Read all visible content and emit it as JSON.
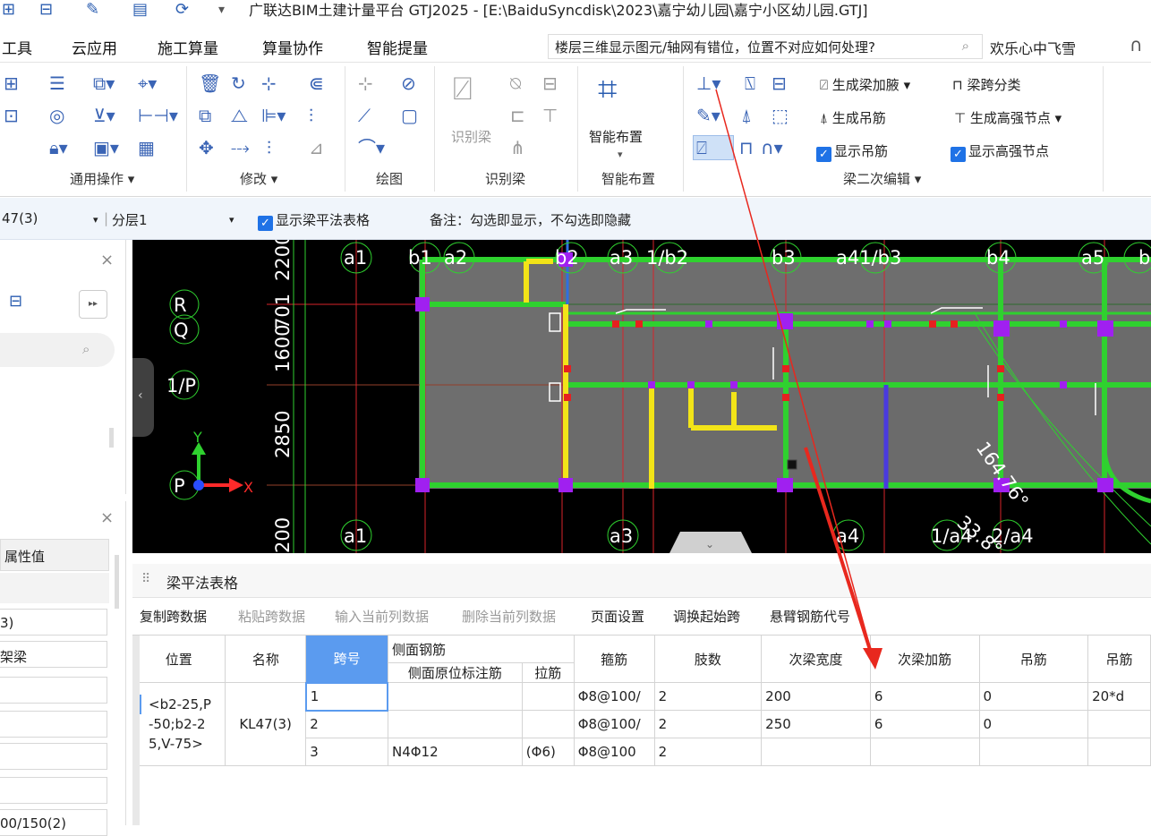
{
  "title_bar": {
    "title": "广联达BIM土建计量平台 GTJ2025 - [E:\\BaiduSyncdisk\\2023\\嘉宁幼儿园\\嘉宁小区幼儿园.GTJ]",
    "quick_icons": [
      "save-icon",
      "grid-icon",
      "pen-icon",
      "table-icon",
      "sync-icon",
      "dropdown-icon"
    ]
  },
  "menu": {
    "items": [
      "工具",
      "云应用",
      "施工算量",
      "算量协作",
      "智能提量"
    ],
    "search_text": "楼层三维显示图元/轴网有错位，位置不对应如何处理?",
    "user": "欢乐心中飞雪"
  },
  "ribbon": {
    "groups": [
      "通用操作",
      "修改",
      "绘图",
      "识别梁",
      "智能布置",
      "梁二次编辑"
    ],
    "identify_beam": "识别梁",
    "smart_layout": "智能布置",
    "beam_edit": {
      "gen_haunch": "生成梁加腋",
      "span_class": "梁跨分类",
      "gen_hanger": "生成吊筋",
      "gen_strong_node": "生成高强节点",
      "show_hanger": "显示吊筋",
      "show_strong_node": "显示高强节点"
    }
  },
  "options_bar": {
    "element": "47(3)",
    "layer": "分层1",
    "show_table": "显示梁平法表格",
    "note": "备注：勾选即显示，不勾选即隐藏"
  },
  "left_panel": {
    "header": "属性值",
    "values": [
      "3)",
      "架梁",
      "",
      "",
      "",
      "",
      "00/150(2)"
    ]
  },
  "canvas": {
    "axes_top": [
      "a1",
      "b1",
      "a2",
      "b2",
      "a3",
      "1/b2",
      "b3",
      "a41/b3",
      "b4",
      "a5",
      "b"
    ],
    "axes_bottom": [
      "a1",
      "a3",
      "a4",
      "1/a4",
      "2/a4"
    ],
    "axes_left": [
      "R",
      "Q",
      "1/P",
      "P"
    ],
    "dims": [
      "2200",
      "701",
      "1600",
      "2850",
      "200"
    ],
    "angles": [
      "164.76°",
      "33.8°"
    ],
    "coord_x": "X",
    "coord_y": "Y"
  },
  "table_panel": {
    "title": "梁平法表格",
    "toolbar": [
      "复制跨数据",
      "粘贴跨数据",
      "输入当前列数据",
      "删除当前列数据",
      "页面设置",
      "调换起始跨",
      "悬臂钢筋代号"
    ],
    "headers": {
      "pos": "位置",
      "name": "名称",
      "span": "跨号",
      "side": "侧面钢筋",
      "side_mark": "侧面原位标注筋",
      "tie": "拉筋",
      "stirrup": "箍筋",
      "legs": "肢数",
      "sec_width": "次梁宽度",
      "sec_add": "次梁加筋",
      "hanger": "吊筋",
      "hanger2": "吊筋"
    },
    "pos_text": [
      "<b2-25,P",
      "-50;b2-2",
      "5,V-75>"
    ],
    "name": "KL47(3)",
    "rows": [
      {
        "n": "1",
        "span": "1",
        "side_mark": "",
        "tie": "",
        "stirrup": "Φ8@100/",
        "legs": "2",
        "sec_width": "200",
        "sec_add": "6",
        "hanger": "0",
        "hanger2": "20*d"
      },
      {
        "n": "2",
        "span": "2",
        "side_mark": "",
        "tie": "",
        "stirrup": "Φ8@100/",
        "legs": "2",
        "sec_width": "250",
        "sec_add": "6",
        "hanger": "0",
        "hanger2": ""
      },
      {
        "n": "3",
        "span": "3",
        "side_mark": "N4Φ12",
        "tie": "(Φ6)",
        "stirrup": "Φ8@100",
        "legs": "2",
        "sec_width": "",
        "sec_add": "",
        "hanger": "",
        "hanger2": ""
      }
    ]
  }
}
